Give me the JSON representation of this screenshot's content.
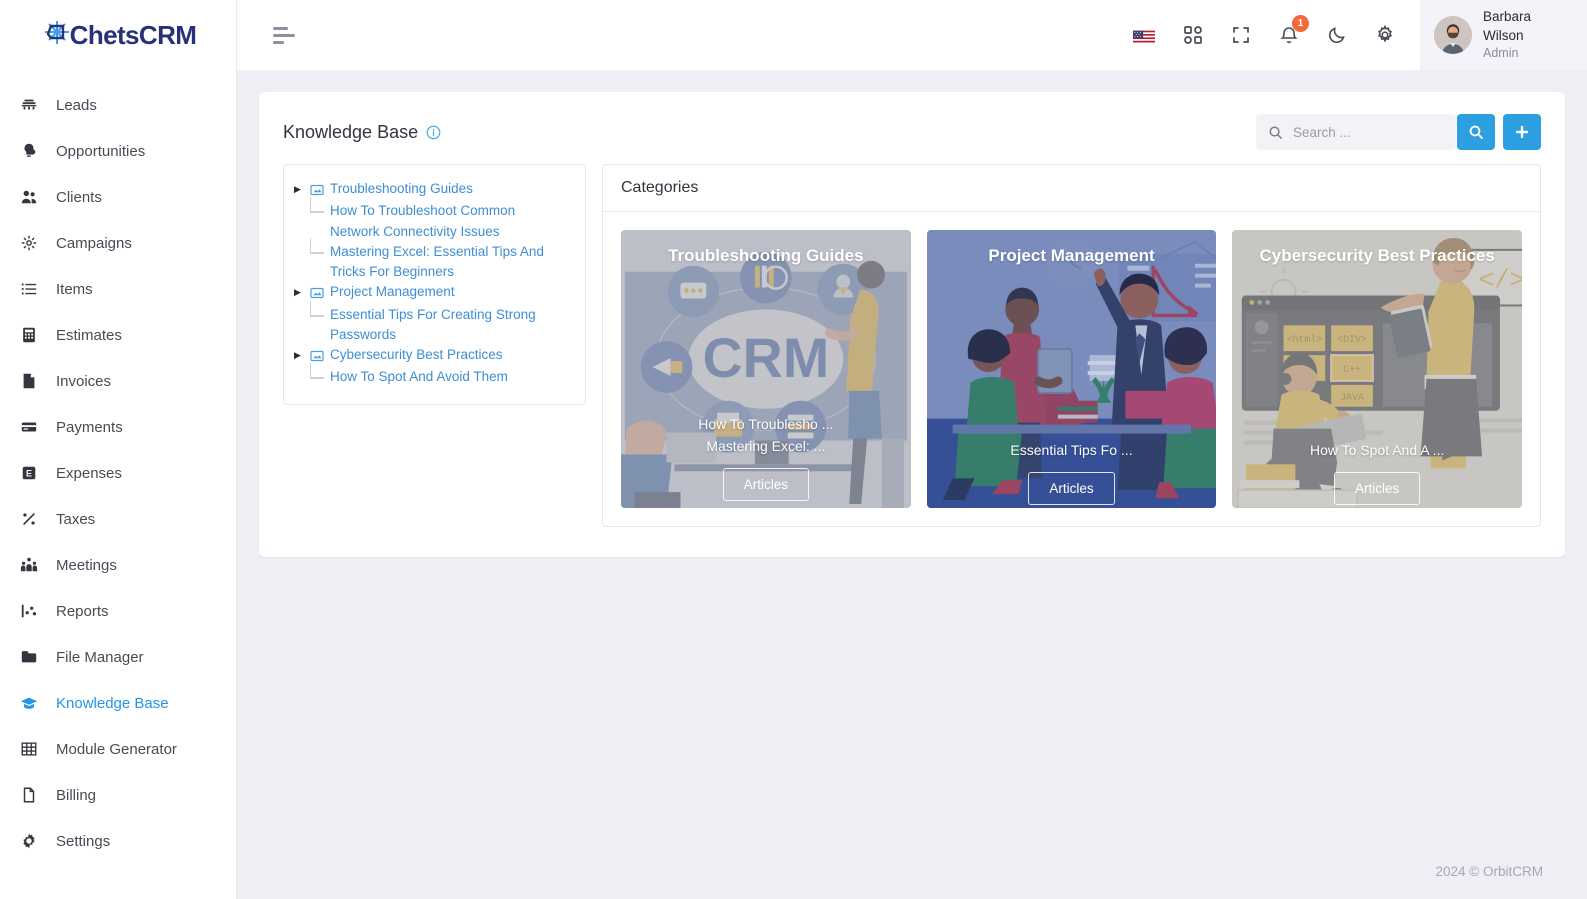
{
  "brand": {
    "name": "ChetsCRM",
    "logo_icon": "crm-compass-logo"
  },
  "sidebar": {
    "items": [
      {
        "label": "Leads",
        "icon": "leads-icon",
        "active": false
      },
      {
        "label": "Opportunities",
        "icon": "opportunities-icon",
        "active": false
      },
      {
        "label": "Clients",
        "icon": "clients-icon",
        "active": false
      },
      {
        "label": "Campaigns",
        "icon": "campaigns-icon",
        "active": false
      },
      {
        "label": "Items",
        "icon": "items-icon",
        "active": false
      },
      {
        "label": "Estimates",
        "icon": "estimates-icon",
        "active": false
      },
      {
        "label": "Invoices",
        "icon": "invoices-icon",
        "active": false
      },
      {
        "label": "Payments",
        "icon": "payments-icon",
        "active": false
      },
      {
        "label": "Expenses",
        "icon": "expenses-icon",
        "active": false
      },
      {
        "label": "Taxes",
        "icon": "taxes-icon",
        "active": false
      },
      {
        "label": "Meetings",
        "icon": "meetings-icon",
        "active": false
      },
      {
        "label": "Reports",
        "icon": "reports-icon",
        "active": false
      },
      {
        "label": "File Manager",
        "icon": "folder-icon",
        "active": false
      },
      {
        "label": "Knowledge Base",
        "icon": "graduation-cap-icon",
        "active": true
      },
      {
        "label": "Module Generator",
        "icon": "grid-icon",
        "active": false
      },
      {
        "label": "Billing",
        "icon": "billing-icon",
        "active": false
      },
      {
        "label": "Settings",
        "icon": "gear-icon",
        "active": false
      }
    ]
  },
  "topbar": {
    "menu_toggle": "hamburger-menu-icon",
    "language_flag": "us-flag-icon",
    "apps_icon": "apps-grid-icon",
    "fullscreen_icon": "fullscreen-icon",
    "notifications_icon": "bell-icon",
    "notifications_count": "1",
    "dark_mode_icon": "moon-icon",
    "settings_icon": "gear-icon",
    "profile": {
      "name": "Barbara Wilson",
      "role": "Admin"
    }
  },
  "page": {
    "title": "Knowledge Base",
    "info_icon": "info-circle-icon",
    "search": {
      "value": "",
      "placeholder": "Search ..."
    },
    "search_button_icon": "search-icon",
    "add_button_icon": "plus-icon"
  },
  "tree": {
    "nodes": [
      {
        "label": "Troubleshooting Guides",
        "children": [
          "How To Troubleshoot Common Network Connectivity Issues",
          "Mastering Excel: Essential Tips And Tricks For Beginners"
        ]
      },
      {
        "label": "Project Management",
        "children": [
          "Essential Tips For Creating Strong Passwords"
        ]
      },
      {
        "label": "Cybersecurity Best Practices",
        "children": [
          "How To Spot And Avoid Them"
        ]
      }
    ]
  },
  "categories": {
    "heading": "Categories",
    "cards": [
      {
        "title": "Troubleshooting Guides",
        "articles": [
          "How To Troublesho ...",
          "Mastering Excel: ..."
        ],
        "button": "Articles",
        "scene": "crm-cloud-illustration",
        "tint": "#b0b0b3"
      },
      {
        "title": "Project Management",
        "articles": [
          "Essential Tips Fo ..."
        ],
        "button": "Articles",
        "scene": "team-meeting-illustration",
        "tint": "#4a5fa5"
      },
      {
        "title": "Cybersecurity Best Practices",
        "articles": [
          "How To Spot And A ..."
        ],
        "button": "Articles",
        "scene": "coding-classroom-illustration",
        "tint": "#b3b2ae"
      }
    ]
  },
  "footer": {
    "copyright": "2024 © OrbitCRM"
  },
  "colors": {
    "accent": "#2c9fe0",
    "link": "#3d8ed4",
    "badge": "#f4683c",
    "page_bg": "#eeeef5"
  }
}
